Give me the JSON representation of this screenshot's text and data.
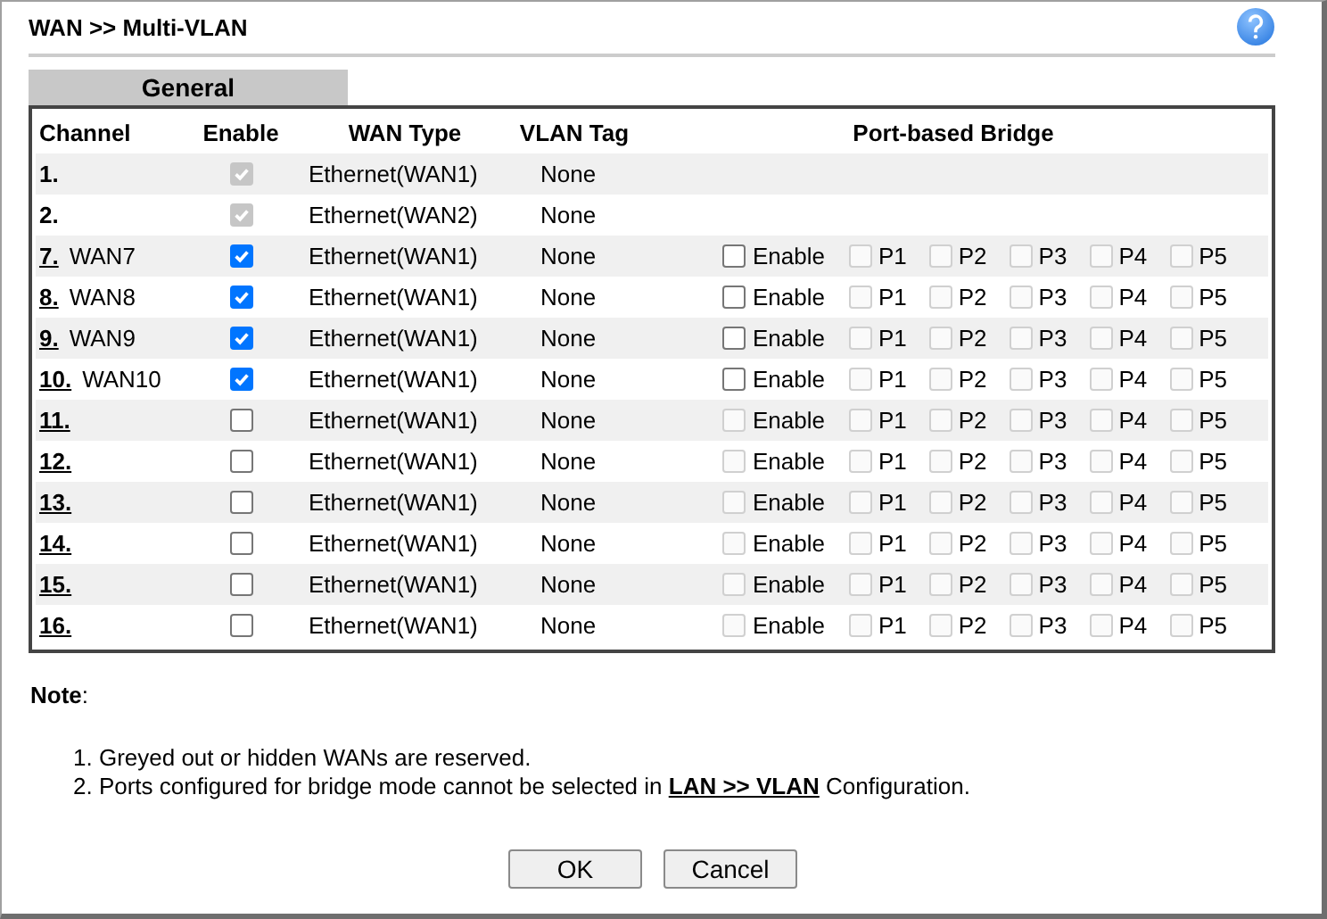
{
  "page_title": "WAN >> Multi-VLAN",
  "tab": {
    "label": "General",
    "selected": true
  },
  "columns": [
    "Channel",
    "Enable",
    "WAN Type",
    "VLAN Tag",
    "Port-based Bridge"
  ],
  "rows": [
    {
      "channel": "1.",
      "link": false,
      "enable": {
        "checked": true,
        "disabled": true
      },
      "wan_type": "Ethernet(WAN1)",
      "vlan_tag": "None"
    },
    {
      "channel": "2.",
      "link": false,
      "enable": {
        "checked": true,
        "disabled": true
      },
      "wan_type": "Ethernet(WAN2)",
      "vlan_tag": "None"
    },
    {
      "channel": "7.",
      "name": "WAN7",
      "link": true,
      "enable": {
        "checked": true,
        "disabled": false
      },
      "wan_type": "Ethernet(WAN1)",
      "vlan_tag": "None",
      "bridge": {
        "label": "Enable",
        "checked": false,
        "disabled": false,
        "ports": [
          {
            "label": "P1",
            "checked": false,
            "disabled": true
          },
          {
            "label": "P2",
            "checked": false,
            "disabled": true
          },
          {
            "label": "P3",
            "checked": false,
            "disabled": true
          },
          {
            "label": "P4",
            "checked": false,
            "disabled": true
          },
          {
            "label": "P5",
            "checked": false,
            "disabled": true
          }
        ]
      }
    },
    {
      "channel": "8.",
      "name": "WAN8",
      "link": true,
      "enable": {
        "checked": true,
        "disabled": false
      },
      "wan_type": "Ethernet(WAN1)",
      "vlan_tag": "None",
      "bridge": {
        "label": "Enable",
        "checked": false,
        "disabled": false,
        "ports": [
          {
            "label": "P1",
            "checked": false,
            "disabled": true
          },
          {
            "label": "P2",
            "checked": false,
            "disabled": true
          },
          {
            "label": "P3",
            "checked": false,
            "disabled": true
          },
          {
            "label": "P4",
            "checked": false,
            "disabled": true
          },
          {
            "label": "P5",
            "checked": false,
            "disabled": true
          }
        ]
      }
    },
    {
      "channel": "9.",
      "name": "WAN9",
      "link": true,
      "enable": {
        "checked": true,
        "disabled": false
      },
      "wan_type": "Ethernet(WAN1)",
      "vlan_tag": "None",
      "bridge": {
        "label": "Enable",
        "checked": false,
        "disabled": false,
        "ports": [
          {
            "label": "P1",
            "checked": false,
            "disabled": true
          },
          {
            "label": "P2",
            "checked": false,
            "disabled": true
          },
          {
            "label": "P3",
            "checked": false,
            "disabled": true
          },
          {
            "label": "P4",
            "checked": false,
            "disabled": true
          },
          {
            "label": "P5",
            "checked": false,
            "disabled": true
          }
        ]
      }
    },
    {
      "channel": "10.",
      "name": "WAN10",
      "link": true,
      "enable": {
        "checked": true,
        "disabled": false
      },
      "wan_type": "Ethernet(WAN1)",
      "vlan_tag": "None",
      "bridge": {
        "label": "Enable",
        "checked": false,
        "disabled": false,
        "ports": [
          {
            "label": "P1",
            "checked": false,
            "disabled": true
          },
          {
            "label": "P2",
            "checked": false,
            "disabled": true
          },
          {
            "label": "P3",
            "checked": false,
            "disabled": true
          },
          {
            "label": "P4",
            "checked": false,
            "disabled": true
          },
          {
            "label": "P5",
            "checked": false,
            "disabled": true
          }
        ]
      }
    },
    {
      "channel": "11.",
      "link": true,
      "enable": {
        "checked": false,
        "disabled": false
      },
      "wan_type": "Ethernet(WAN1)",
      "vlan_tag": "None",
      "bridge": {
        "label": "Enable",
        "checked": false,
        "disabled": true,
        "ports": [
          {
            "label": "P1",
            "checked": false,
            "disabled": true
          },
          {
            "label": "P2",
            "checked": false,
            "disabled": true
          },
          {
            "label": "P3",
            "checked": false,
            "disabled": true
          },
          {
            "label": "P4",
            "checked": false,
            "disabled": true
          },
          {
            "label": "P5",
            "checked": false,
            "disabled": true
          }
        ]
      }
    },
    {
      "channel": "12.",
      "link": true,
      "enable": {
        "checked": false,
        "disabled": false
      },
      "wan_type": "Ethernet(WAN1)",
      "vlan_tag": "None",
      "bridge": {
        "label": "Enable",
        "checked": false,
        "disabled": true,
        "ports": [
          {
            "label": "P1",
            "checked": false,
            "disabled": true
          },
          {
            "label": "P2",
            "checked": false,
            "disabled": true
          },
          {
            "label": "P3",
            "checked": false,
            "disabled": true
          },
          {
            "label": "P4",
            "checked": false,
            "disabled": true
          },
          {
            "label": "P5",
            "checked": false,
            "disabled": true
          }
        ]
      }
    },
    {
      "channel": "13.",
      "link": true,
      "enable": {
        "checked": false,
        "disabled": false
      },
      "wan_type": "Ethernet(WAN1)",
      "vlan_tag": "None",
      "bridge": {
        "label": "Enable",
        "checked": false,
        "disabled": true,
        "ports": [
          {
            "label": "P1",
            "checked": false,
            "disabled": true
          },
          {
            "label": "P2",
            "checked": false,
            "disabled": true
          },
          {
            "label": "P3",
            "checked": false,
            "disabled": true
          },
          {
            "label": "P4",
            "checked": false,
            "disabled": true
          },
          {
            "label": "P5",
            "checked": false,
            "disabled": true
          }
        ]
      }
    },
    {
      "channel": "14.",
      "link": true,
      "enable": {
        "checked": false,
        "disabled": false
      },
      "wan_type": "Ethernet(WAN1)",
      "vlan_tag": "None",
      "bridge": {
        "label": "Enable",
        "checked": false,
        "disabled": true,
        "ports": [
          {
            "label": "P1",
            "checked": false,
            "disabled": true
          },
          {
            "label": "P2",
            "checked": false,
            "disabled": true
          },
          {
            "label": "P3",
            "checked": false,
            "disabled": true
          },
          {
            "label": "P4",
            "checked": false,
            "disabled": true
          },
          {
            "label": "P5",
            "checked": false,
            "disabled": true
          }
        ]
      }
    },
    {
      "channel": "15.",
      "link": true,
      "enable": {
        "checked": false,
        "disabled": false
      },
      "wan_type": "Ethernet(WAN1)",
      "vlan_tag": "None",
      "bridge": {
        "label": "Enable",
        "checked": false,
        "disabled": true,
        "ports": [
          {
            "label": "P1",
            "checked": false,
            "disabled": true
          },
          {
            "label": "P2",
            "checked": false,
            "disabled": true
          },
          {
            "label": "P3",
            "checked": false,
            "disabled": true
          },
          {
            "label": "P4",
            "checked": false,
            "disabled": true
          },
          {
            "label": "P5",
            "checked": false,
            "disabled": true
          }
        ]
      }
    },
    {
      "channel": "16.",
      "link": true,
      "enable": {
        "checked": false,
        "disabled": false
      },
      "wan_type": "Ethernet(WAN1)",
      "vlan_tag": "None",
      "bridge": {
        "label": "Enable",
        "checked": false,
        "disabled": true,
        "ports": [
          {
            "label": "P1",
            "checked": false,
            "disabled": true
          },
          {
            "label": "P2",
            "checked": false,
            "disabled": true
          },
          {
            "label": "P3",
            "checked": false,
            "disabled": true
          },
          {
            "label": "P4",
            "checked": false,
            "disabled": true
          },
          {
            "label": "P5",
            "checked": false,
            "disabled": true
          }
        ]
      }
    }
  ],
  "note": {
    "heading": "**Note**:",
    "items": [
      "1. Greyed out or hidden WANs are reserved.",
      "2. Ports configured for bridge mode cannot be selected in **LAN >> VLAN** Configuration."
    ]
  },
  "buttons": [
    "OK",
    "Cancel"
  ]
}
